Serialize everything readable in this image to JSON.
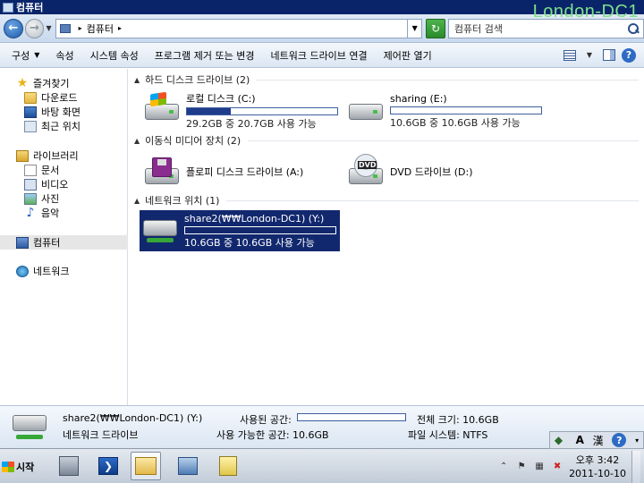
{
  "window": {
    "title": "컴퓨터",
    "watermark": "London-DC1"
  },
  "address": {
    "crumb": "컴퓨터",
    "search_placeholder": "컴퓨터 검색"
  },
  "toolbar": {
    "organize": "구성",
    "properties": "속성",
    "system_properties": "시스템 속성",
    "uninstall": "프로그램 제거 또는 변경",
    "map_drive": "네트워크 드라이브 연결",
    "control_panel": "제어판 열기"
  },
  "nav": {
    "favorites": "즐겨찾기",
    "downloads": "다운로드",
    "desktop": "바탕 화면",
    "recent": "최근 위치",
    "libraries": "라이브러리",
    "documents": "문서",
    "videos": "비디오",
    "pictures": "사진",
    "music": "음악",
    "computer": "컴퓨터",
    "network": "네트워크"
  },
  "groups": {
    "hdd": "하드 디스크 드라이브 (2)",
    "removable": "이동식 미디어 장치 (2)",
    "network": "네트워크 위치 (1)"
  },
  "drives": {
    "c": {
      "name": "로컬 디스크 (C:)",
      "size": "29.2GB 중 20.7GB 사용 가능",
      "used_fraction": 0.29
    },
    "e": {
      "name": "sharing (E:)",
      "size": "10.6GB 중 10.6GB 사용 가능",
      "used_fraction": 0.0
    },
    "a": {
      "name": "플로피 디스크 드라이브 (A:)"
    },
    "d": {
      "name": "DVD 드라이브 (D:)",
      "dvd_label": "DVD"
    },
    "y": {
      "name": "share2(₩₩London-DC1) (Y:)",
      "size": "10.6GB 중 10.6GB 사용 가능",
      "used_fraction": 0.0
    }
  },
  "details": {
    "name": "share2(₩₩London-DC1) (Y:)",
    "type": "네트워크 드라이브",
    "used_label": "사용된 공간:",
    "free_label": "사용 가능한 공간: 10.6GB",
    "total_label": "전체 크기: 10.6GB",
    "fs_label": "파일 시스템: NTFS"
  },
  "langbar": {
    "mode": "A",
    "hanja": "漢"
  },
  "taskbar": {
    "start": "시작",
    "clock_time": "오후 3:42",
    "clock_date": "2011-10-10"
  }
}
